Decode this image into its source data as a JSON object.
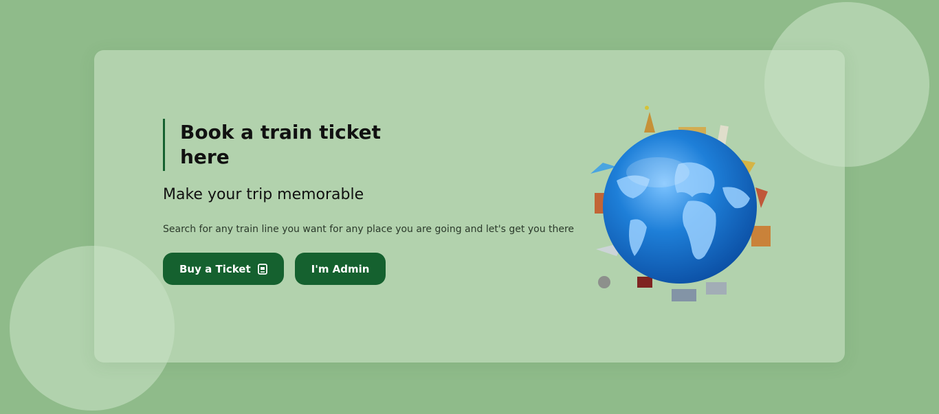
{
  "hero": {
    "title": "Book a train ticket here",
    "subtitle": "Make your trip memorable",
    "description": "Search for any train line you want for any place you are going and let's get you there"
  },
  "actions": {
    "buy_label": "Buy a Ticket",
    "admin_label": "I'm Admin"
  },
  "icons": {
    "buy": "ticket-icon",
    "illustration": "globe-landmarks-illustration"
  },
  "colors": {
    "background": "#8fbb8a",
    "card": "#b3d1b0",
    "accent": "#15612f",
    "globe": "#1e7fd8"
  }
}
